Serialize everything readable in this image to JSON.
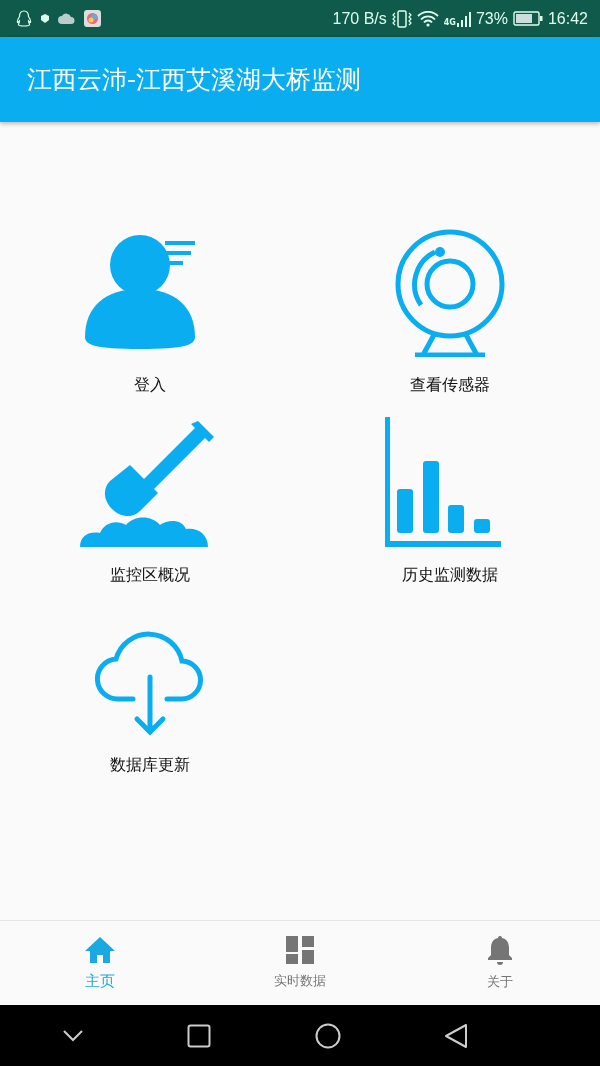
{
  "status_bar": {
    "net_speed": "170 B/s",
    "network": "4G",
    "battery": "73%",
    "time": "16:42"
  },
  "app_bar": {
    "title": "江西云沛-江西艾溪湖大桥监测"
  },
  "tiles": [
    {
      "kind": "person",
      "label": "登入"
    },
    {
      "kind": "sensor",
      "label": "查看传感器"
    },
    {
      "kind": "shovel",
      "label": "监控区概况"
    },
    {
      "kind": "chart",
      "label": "历史监测数据"
    },
    {
      "kind": "cloud",
      "label": "数据库更新"
    }
  ],
  "bottom_nav": [
    {
      "kind": "home",
      "label": "主页",
      "selected": true
    },
    {
      "kind": "grid",
      "label": "实时数据",
      "selected": false
    },
    {
      "kind": "bell",
      "label": "关于",
      "selected": false
    }
  ]
}
